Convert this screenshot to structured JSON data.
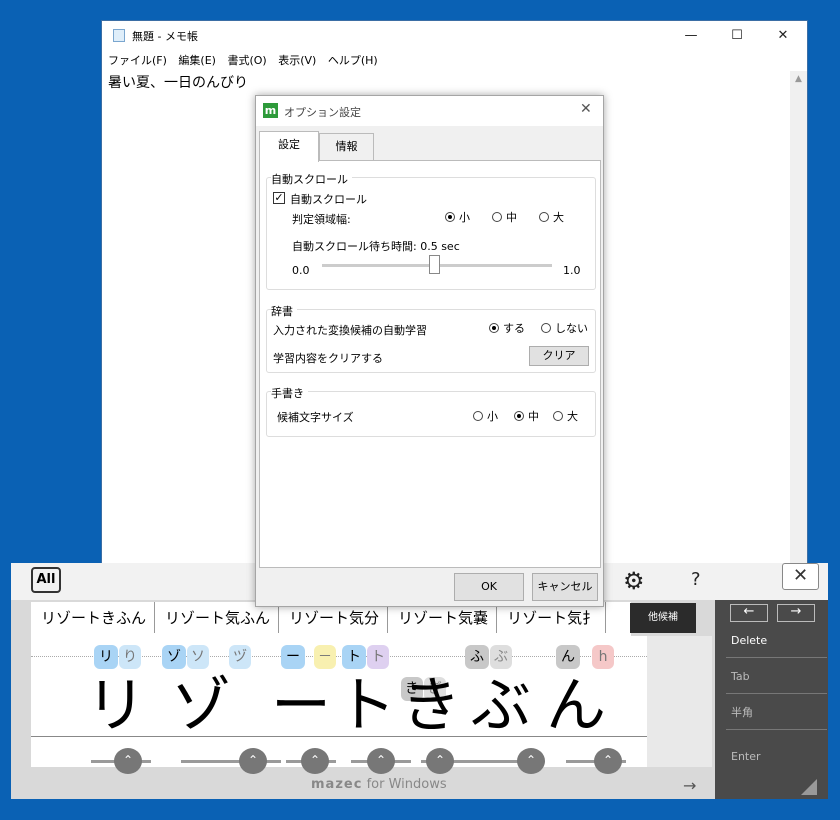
{
  "notepad": {
    "title": "無題 - メモ帳",
    "window_buttons": {
      "minimize": "—",
      "maximize": "☐",
      "close": "✕"
    },
    "menu": [
      "ファイル(F)",
      "編集(E)",
      "書式(O)",
      "表示(V)",
      "ヘルプ(H)"
    ],
    "content": "暑い夏、一日のんびり"
  },
  "dialog": {
    "title": "オプション設定",
    "close": "✕",
    "tabs": [
      "設定",
      "情報"
    ],
    "auto_scroll": {
      "header": "自動スクロール",
      "checkbox_label": "自動スクロール",
      "checked": true,
      "width_label": "判定領域幅:",
      "width_options": [
        "小",
        "中",
        "大"
      ],
      "width_selected": "小",
      "wait_label": "自動スクロール待ち時間: 0.5 sec",
      "slider_min": "0.0",
      "slider_max": "1.0",
      "slider_value": 0.5
    },
    "dictionary": {
      "header": "辞書",
      "learn_label": "入力された変換候補の自動学習",
      "learn_options": [
        "する",
        "しない"
      ],
      "learn_selected": "する",
      "clear_label": "学習内容をクリアする",
      "clear_button": "クリア"
    },
    "handwriting": {
      "header": "手書き",
      "size_label": "候補文字サイズ",
      "size_options": [
        "小",
        "中",
        "大"
      ],
      "size_selected": "中"
    },
    "ok_button": "OK",
    "cancel_button": "キャンセル"
  },
  "keyboard": {
    "all_button": "All",
    "close": "✕",
    "help": "?",
    "candidates": [
      "リゾートきふん",
      "リゾート気ふん",
      "リゾート気分",
      "リゾート気嚢",
      "リゾート気扌"
    ],
    "more_candidates": "他候補",
    "chips": [
      "リ",
      "り",
      "ゾ",
      "ソ",
      "ヅ",
      "ー",
      "－",
      "ト",
      "ト",
      "ふ",
      "ぶ",
      "ん",
      "h",
      "き",
      "ぎ"
    ],
    "handwriting": [
      "リ",
      "ゾ",
      "ー",
      "ト",
      "き",
      "ぶ",
      "ん"
    ],
    "keys": {
      "left": "←",
      "right": "→",
      "delete": "Delete",
      "tab": "Tab",
      "hankaku": "半角",
      "enter": "Enter"
    },
    "brand": "mazec",
    "brand_suffix": "for Windows",
    "arrow": "→"
  },
  "colors": {
    "desktop": "#0a61b4",
    "accent": "#2d9a3a"
  }
}
